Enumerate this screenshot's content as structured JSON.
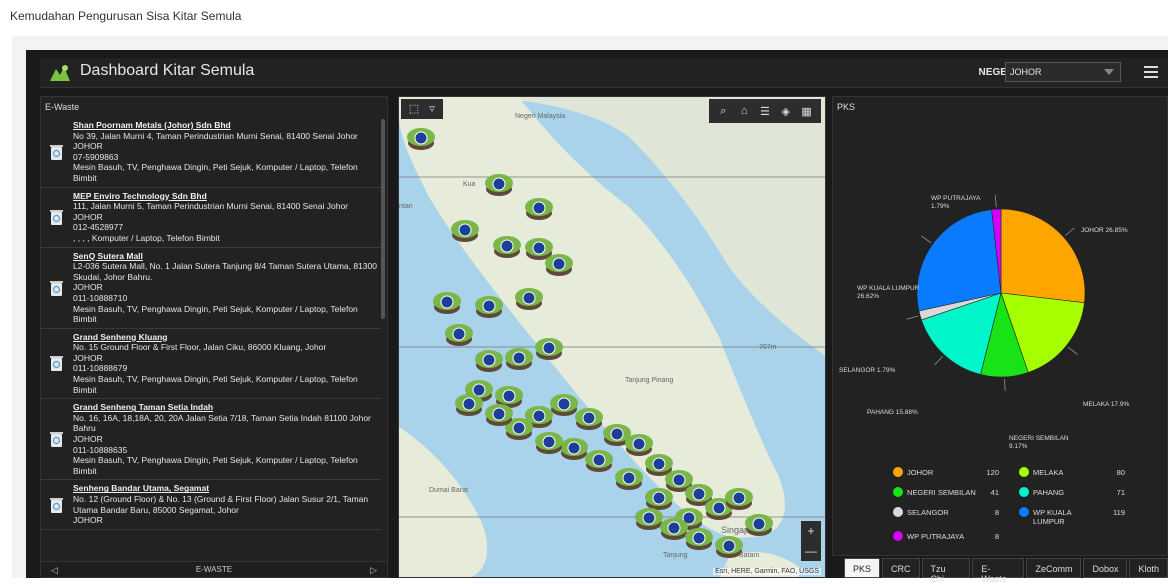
{
  "page_title": "Kemudahan Pengurusan Sisa Kitar Semula",
  "header": {
    "title": "Dashboard Kitar Semula",
    "negeri_label": "NEGERI :",
    "negeri_value": "JOHOR"
  },
  "list_panel": {
    "title": "E-Waste",
    "footer_label": "E-WASTE",
    "items": [
      {
        "name": "Shan Poornam Metals (Johor) Sdn Bhd",
        "lines": [
          "No 39, Jalan Murni 4, Taman Perindustrian Murni Senai, 81400 Senai Johor",
          "JOHOR",
          "07-5909863",
          "Mesin Basuh, TV, Penghawa Dingin, Peti Sejuk, Komputer / Laptop, Telefon Bimbit"
        ]
      },
      {
        "name": "MEP Enviro Technology Sdn Bhd",
        "lines": [
          "111, Jalan Murni 5, Taman Perindustrian Murni Senai, 81400 Senai Johor",
          "JOHOR",
          "012-4528977",
          ", , , , Komputer / Laptop, Telefon Bimbit"
        ]
      },
      {
        "name": "SenQ Sutera Mall",
        "lines": [
          "L2-036 Sutera Mall, No. 1 Jalan Sutera Tanjung 8/4 Taman Sutera Utama, 81300 Skudai, Johor Bahru.",
          "JOHOR",
          "011-10888710",
          "Mesin Basuh, TV, Penghawa Dingin, Peti Sejuk, Komputer / Laptop, Telefon Bimbit"
        ]
      },
      {
        "name": "Grand Senheng Kluang",
        "lines": [
          "No. 15 Ground Floor & First Floor,  Jalan Ciku, 86000 Kluang, Johor",
          "JOHOR",
          "011-10888679",
          "Mesin Basuh, TV, Penghawa Dingin, Peti Sejuk, Komputer / Laptop, Telefon Bimbit"
        ]
      },
      {
        "name": "Grand Senheng Taman Setia Indah",
        "lines": [
          "No. 16, 16A, 18,18A, 20, 20A Jalan Setia 7/18, Taman Setia Indah 81100 Johor Bahru",
          "JOHOR",
          "011-10888635",
          "Mesin Basuh, TV, Penghawa Dingin, Peti Sejuk, Komputer / Laptop, Telefon Bimbit"
        ]
      },
      {
        "name": "Senheng Bandar Utama, Segamat",
        "lines": [
          "No. 12 (Ground Floor) & No. 13 (Ground & First Floor) Jalan Susur 2/1, Taman Utama Bandar Baru, 85000 Segamat, Johor",
          "JOHOR"
        ]
      }
    ]
  },
  "map": {
    "attribution": "Esri, HERE, Garmin, FAO, USGS",
    "place_labels": [
      "Dumai Barat",
      "Singap",
      "Tanjung",
      "Batam",
      "Kua",
      "ntan",
      "707m",
      "Tanjung Pinang",
      "Negeri Malaysia"
    ],
    "zoom_in": "+",
    "zoom_out": "—"
  },
  "pks_panel": {
    "title": "PKS"
  },
  "chart_data": {
    "type": "pie",
    "title": "PKS",
    "slices": [
      {
        "name": "JOHOR",
        "value": 120,
        "percent_label": "JOHOR 26.85%",
        "color": "#ffa500"
      },
      {
        "name": "MELAKA",
        "value": 80,
        "percent_label": "MELAKA 17.9%",
        "color": "#a6ff00"
      },
      {
        "name": "NEGERI SEMBILAN",
        "value": 41,
        "percent_label": "NEGERI SEMBILAN 9.17%",
        "color": "#17e317"
      },
      {
        "name": "PAHANG",
        "value": 71,
        "percent_label": "PAHANG 15.88%",
        "color": "#00f5c8"
      },
      {
        "name": "SELANGOR",
        "value": 8,
        "percent_label": "SELANGOR 1.79%",
        "color": "#d9d9d9"
      },
      {
        "name": "WP KUALA LUMPUR",
        "value": 119,
        "percent_label": "WP KUALA LUMPUR 26.62%",
        "color": "#0a7bff"
      },
      {
        "name": "WP PUTRAJAYA",
        "value": 8,
        "percent_label": "WP PUTRAJAYA 1.79%",
        "color": "#d400ff"
      }
    ],
    "legend_position": "bottom"
  },
  "tabs": [
    "PKS",
    "CRC",
    "Tzu Chi",
    "E-Waste",
    "ZeComm",
    "Dobox",
    "Kloth"
  ],
  "active_tab": "PKS"
}
